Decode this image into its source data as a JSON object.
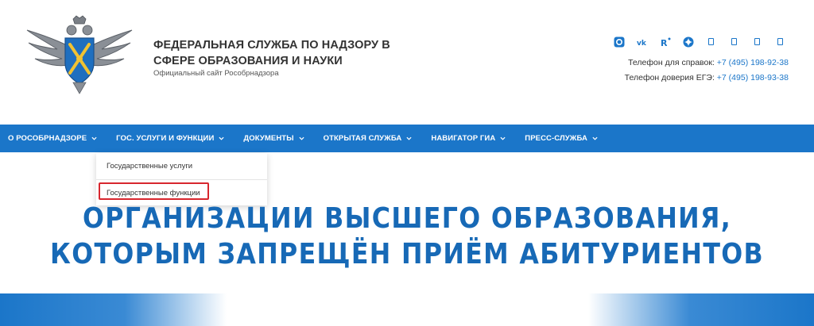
{
  "header": {
    "org_title_line1": "ФЕДЕРАЛЬНАЯ СЛУЖБА ПО НАДЗОРУ В",
    "org_title_line2": "СФЕРЕ ОБРАЗОВАНИЯ И НАУКИ",
    "org_subtitle": "Официальный сайт Рособрнадзора",
    "socials": [
      "ok-icon",
      "vk-icon",
      "rutube-icon",
      "dzen-icon",
      "telegram-icon",
      "youtube-icon",
      "twitter-icon",
      "facebook-icon"
    ],
    "phone1_label": "Телефон для справок: ",
    "phone1_number": "+7 (495) 198-92-38",
    "phone2_label": "Телефон доверия ЕГЭ: ",
    "phone2_number": "+7 (495) 198-93-38"
  },
  "nav": {
    "items": [
      {
        "label": "О РОСОБРНАДЗОРЕ"
      },
      {
        "label": "ГОС. УСЛУГИ И ФУНКЦИИ"
      },
      {
        "label": "ДОКУМЕНТЫ"
      },
      {
        "label": "ОТКРЫТАЯ СЛУЖБА"
      },
      {
        "label": "НАВИГАТОР ГИА"
      },
      {
        "label": "ПРЕСС-СЛУЖБА"
      }
    ]
  },
  "dropdown": {
    "items": [
      {
        "label": "Государственные услуги"
      },
      {
        "label": "Государственные функции"
      }
    ]
  },
  "main": {
    "heading_line1": "ОРГАНИЗАЦИИ ВЫСШЕГО ОБРАЗОВАНИЯ,",
    "heading_line2": "КОТОРЫМ ЗАПРЕЩЁН ПРИЁМ АБИТУРИЕНТОВ"
  },
  "colors": {
    "brand_blue": "#1b76c9",
    "heading_blue": "#1769b6",
    "highlight_red": "#d7262e"
  }
}
